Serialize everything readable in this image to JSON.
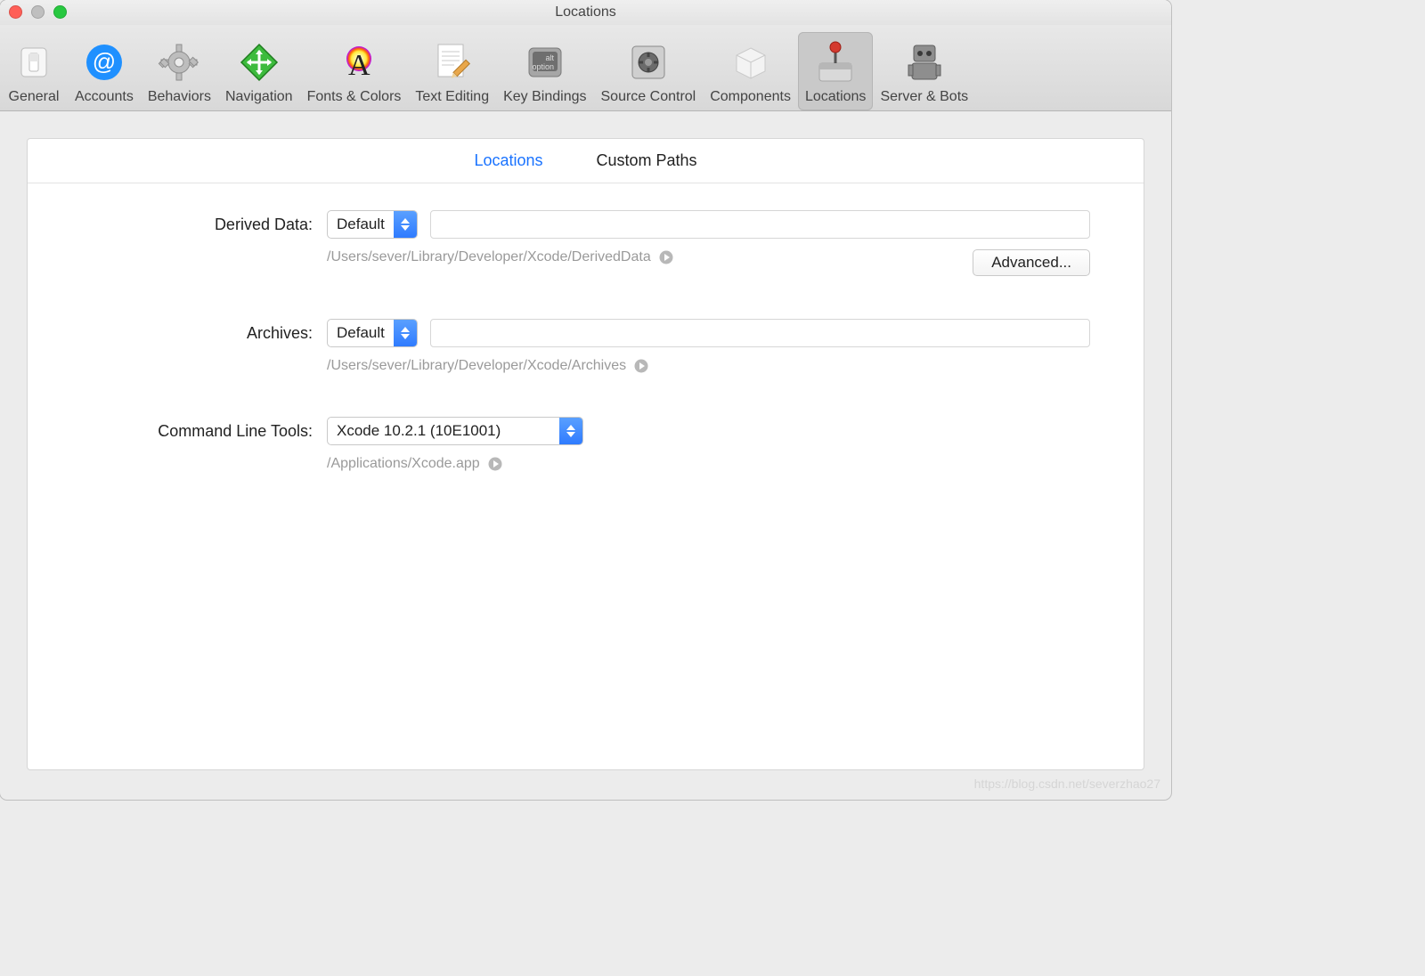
{
  "window": {
    "title": "Locations"
  },
  "toolbar": {
    "items": [
      {
        "label": "General"
      },
      {
        "label": "Accounts"
      },
      {
        "label": "Behaviors"
      },
      {
        "label": "Navigation"
      },
      {
        "label": "Fonts & Colors"
      },
      {
        "label": "Text Editing"
      },
      {
        "label": "Key Bindings"
      },
      {
        "label": "Source Control"
      },
      {
        "label": "Components"
      },
      {
        "label": "Locations"
      },
      {
        "label": "Server & Bots"
      }
    ]
  },
  "tabs": {
    "locations": "Locations",
    "custom_paths": "Custom Paths"
  },
  "derived": {
    "label": "Derived Data:",
    "select": "Default",
    "path": "/Users/sever/Library/Developer/Xcode/DerivedData",
    "advanced": "Advanced..."
  },
  "archives": {
    "label": "Archives:",
    "select": "Default",
    "path": "/Users/sever/Library/Developer/Xcode/Archives"
  },
  "clt": {
    "label": "Command Line Tools:",
    "select": "Xcode 10.2.1 (10E1001)",
    "path": "/Applications/Xcode.app"
  },
  "watermark": "https://blog.csdn.net/severzhao27"
}
